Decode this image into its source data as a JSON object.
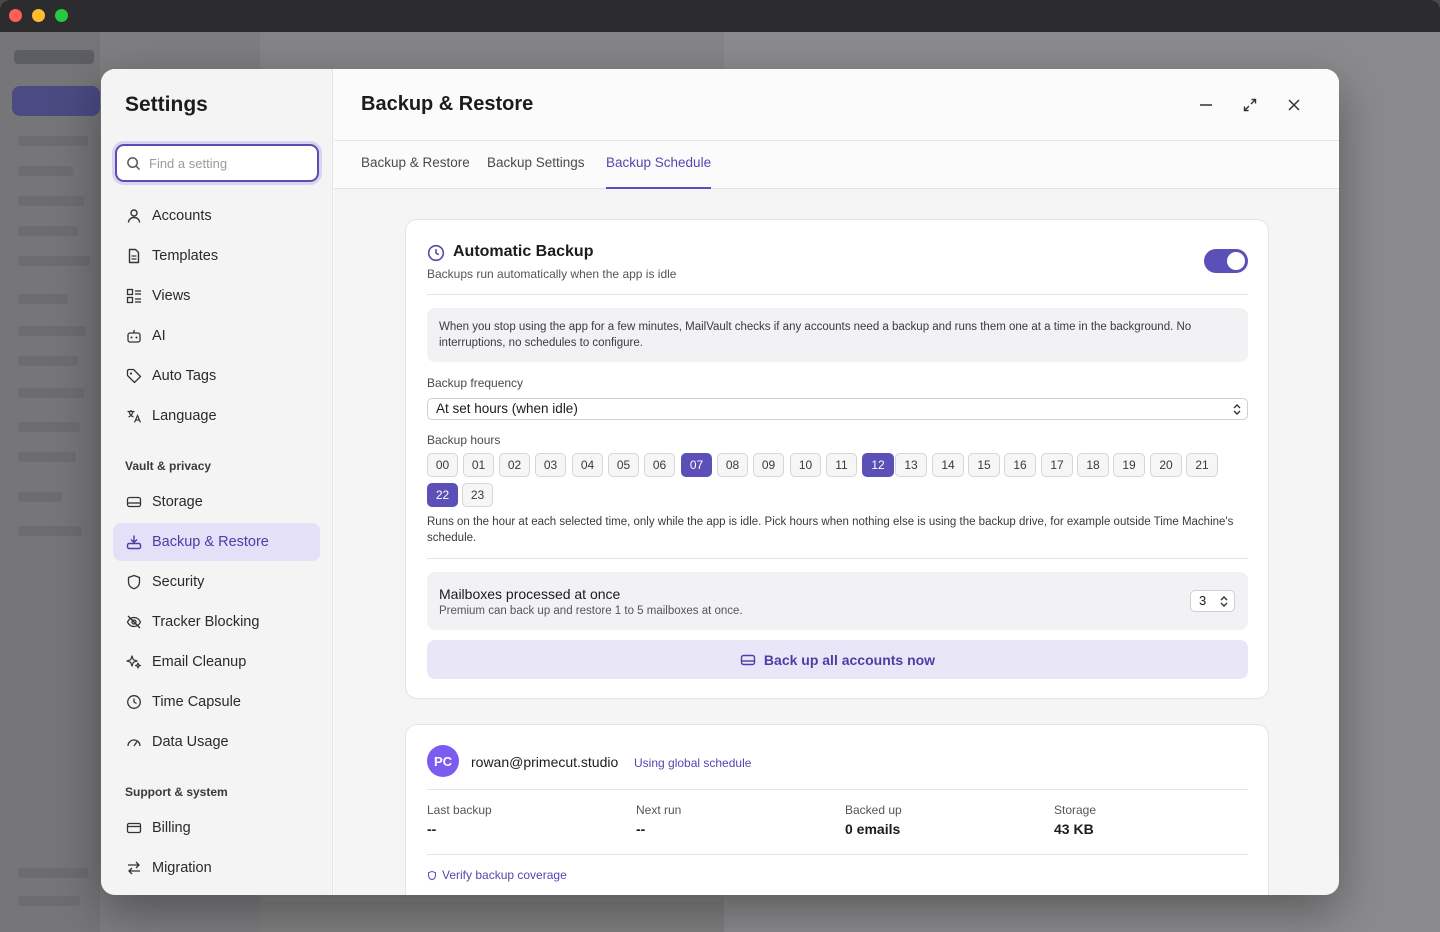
{
  "sidebar": {
    "title": "Settings",
    "search_placeholder": "Find a setting",
    "items": [
      {
        "label": "Accounts",
        "icon": "user-icon"
      },
      {
        "label": "Templates",
        "icon": "document-icon"
      },
      {
        "label": "Views",
        "icon": "views-icon"
      },
      {
        "label": "AI",
        "icon": "robot-icon"
      },
      {
        "label": "Auto Tags",
        "icon": "tag-icon"
      },
      {
        "label": "Language",
        "icon": "translate-icon"
      }
    ],
    "section_vault": "Vault & privacy",
    "vault_items": [
      {
        "label": "Storage",
        "icon": "drive-icon"
      },
      {
        "label": "Backup & Restore",
        "icon": "download-icon",
        "active": true
      },
      {
        "label": "Security",
        "icon": "shield-icon"
      },
      {
        "label": "Tracker Blocking",
        "icon": "eye-off-icon"
      },
      {
        "label": "Email Cleanup",
        "icon": "sparkle-icon"
      },
      {
        "label": "Time Capsule",
        "icon": "clock-icon"
      },
      {
        "label": "Data Usage",
        "icon": "gauge-icon"
      }
    ],
    "section_support": "Support & system",
    "support_items": [
      {
        "label": "Billing",
        "icon": "card-icon"
      },
      {
        "label": "Migration",
        "icon": "arrows-icon"
      }
    ]
  },
  "header": {
    "title": "Backup & Restore"
  },
  "tabs": [
    "Backup & Restore",
    "Backup Settings",
    "Backup Schedule"
  ],
  "active_tab": "Backup Schedule",
  "auto_backup": {
    "title": "Automatic Backup",
    "subtitle": "Backups run automatically when the app is idle",
    "enabled": true,
    "info": "When you stop using the app for a few minutes, MailVault checks if any accounts need a backup and runs them one at a time in the background. No interruptions, no schedules to configure.",
    "frequency_label": "Backup frequency",
    "frequency_value": "At set hours (when idle)",
    "hours_label": "Backup hours",
    "hours": [
      "00",
      "01",
      "02",
      "03",
      "04",
      "05",
      "06",
      "07",
      "08",
      "09",
      "10",
      "11",
      "12",
      "13",
      "14",
      "15",
      "16",
      "17",
      "18",
      "19",
      "20",
      "21",
      "22",
      "23"
    ],
    "selected_hours": [
      "07",
      "12",
      "22"
    ],
    "hours_note": "Runs on the hour at each selected time, only while the app is idle. Pick hours when nothing else is using the backup drive, for example outside Time Machine's schedule.",
    "mailboxes_title": "Mailboxes processed at once",
    "mailboxes_sub": "Premium can back up and restore 1 to 5 mailboxes at once.",
    "mailboxes_value": "3",
    "backup_now": "Back up all accounts now"
  },
  "account": {
    "initials": "PC",
    "email": "rowan@primecut.studio",
    "schedule_tag": "Using global schedule",
    "stats": [
      {
        "label": "Last backup",
        "value": "--"
      },
      {
        "label": "Next run",
        "value": "--"
      },
      {
        "label": "Backed up",
        "value": "0 emails"
      },
      {
        "label": "Storage",
        "value": "43 KB"
      }
    ],
    "verify": "Verify backup coverage"
  },
  "colors": {
    "accent": "#5b4fb8",
    "accent_text": "#4b3ea5",
    "avatar": "#7c5cf0"
  }
}
